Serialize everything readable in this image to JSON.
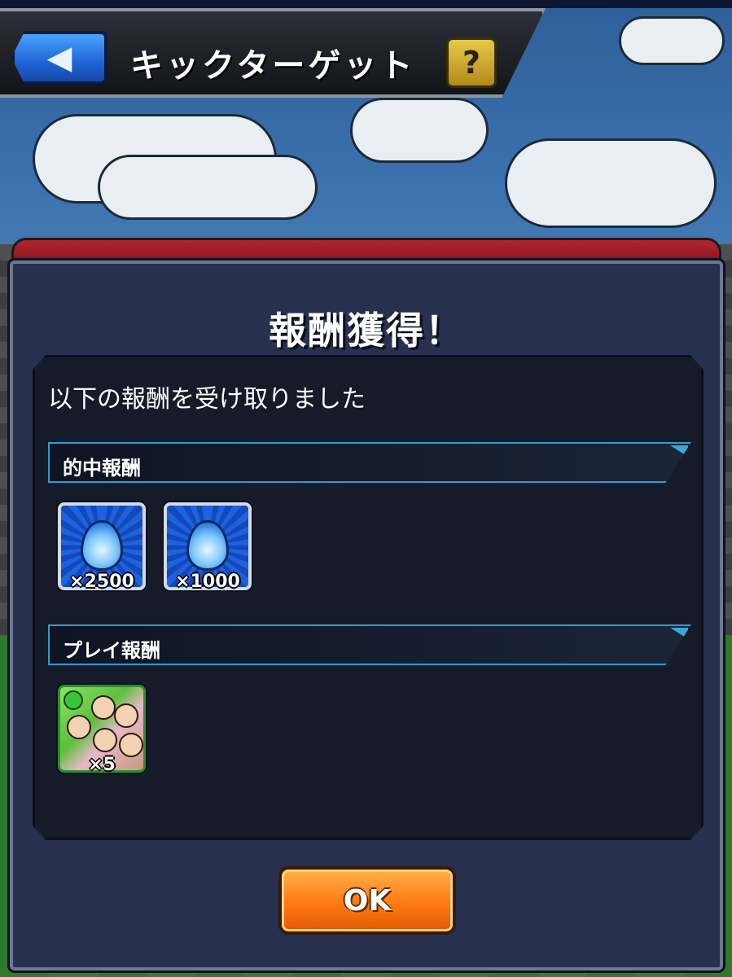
{
  "header": {
    "title": "キックターゲット",
    "back_icon": "back-arrow-icon",
    "help_label": "?"
  },
  "modal": {
    "title": "報酬獲得！",
    "subtitle": "以下の報酬を受け取りました",
    "sections": [
      {
        "label": "的中報酬",
        "items": [
          {
            "icon": "orb-icon",
            "quantity": "×2500"
          },
          {
            "icon": "orb-icon",
            "quantity": "×1000"
          }
        ]
      },
      {
        "label": "プレイ報酬",
        "items": [
          {
            "icon": "character-card-icon",
            "quantity": "×5"
          }
        ]
      }
    ],
    "ok_label": "OK"
  },
  "colors": {
    "modal_bg": "#27314f",
    "section_border": "#2f9ed0",
    "ok_button": "#ff7a12",
    "back_button": "#1f64d6",
    "help_button": "#e7c84a"
  }
}
